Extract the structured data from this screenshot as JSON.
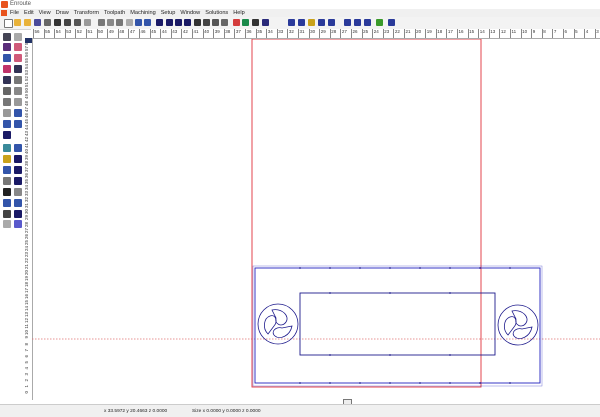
{
  "window": {
    "title": "Enroute"
  },
  "menu": [
    "File",
    "Edit",
    "View",
    "Draw",
    "Transform",
    "Toolpath",
    "Machining",
    "Setup",
    "Window",
    "Solutions",
    "Help"
  ],
  "top_ruler": [
    "56",
    "55",
    "54",
    "53",
    "52",
    "51",
    "50",
    "49",
    "48",
    "47",
    "46",
    "45",
    "44",
    "43",
    "42",
    "41",
    "40",
    "39",
    "38",
    "37",
    "36",
    "35",
    "34",
    "33",
    "32",
    "31",
    "30",
    "29",
    "28",
    "27",
    "26",
    "25",
    "24",
    "23",
    "22",
    "21",
    "20",
    "19",
    "18",
    "17",
    "16",
    "15",
    "14",
    "13",
    "12",
    "11",
    "10",
    "9",
    "8",
    "7",
    "6",
    "5",
    "4",
    "3",
    "2",
    "1",
    "0",
    "1",
    "2",
    "3",
    "4",
    "5",
    "6",
    "7",
    "8",
    "9",
    "10",
    "11",
    "12",
    "13",
    "14",
    "15",
    "16",
    "17",
    "18",
    "19",
    "20",
    "21",
    "22",
    "23",
    "24",
    "25",
    "26",
    "27",
    "28",
    "29",
    "30",
    "31",
    "32",
    "33",
    "34",
    "35",
    "36",
    "37",
    "38",
    "39",
    "40",
    "41",
    "42",
    "43",
    "44",
    "45"
  ],
  "left_ruler": [
    "58",
    "57",
    "56",
    "55",
    "54",
    "53",
    "52",
    "51",
    "50",
    "49",
    "48",
    "47",
    "46",
    "45",
    "44",
    "43",
    "42",
    "41",
    "40",
    "39",
    "38",
    "37",
    "36",
    "35",
    "34",
    "33",
    "32",
    "31",
    "30",
    "29",
    "28",
    "27",
    "26",
    "25",
    "24",
    "23",
    "22",
    "21",
    "20",
    "19",
    "18",
    "17",
    "16",
    "15",
    "14",
    "13",
    "12",
    "11",
    "10",
    "9",
    "8",
    "7",
    "6",
    "5",
    "4",
    "3",
    "2",
    "1",
    "0",
    "-1"
  ],
  "status": {
    "coords": "x 33.5972 y 20.4663 z 0.0000",
    "size": "Size x 0.0000 y 0.0000 z 0.0000"
  },
  "colors": {
    "outline_red": "#e0303a",
    "path_blue": "#1d1a8c",
    "outer_blue": "#2222c0",
    "guide_red": "#e07070"
  }
}
